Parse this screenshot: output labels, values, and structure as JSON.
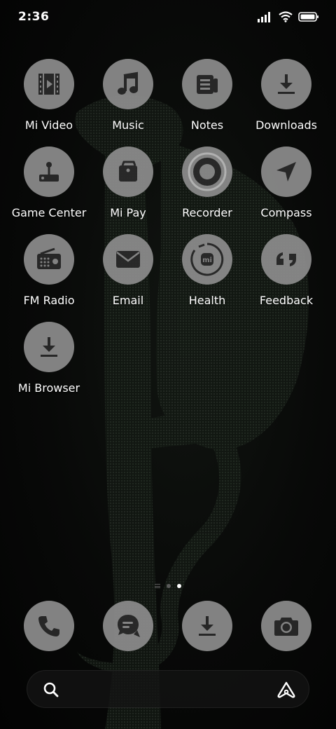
{
  "status_bar": {
    "time": "2:36",
    "icons": [
      "signal-icon",
      "wifi-icon",
      "battery-icon"
    ]
  },
  "apps": [
    {
      "label": "Mi Video",
      "icon": "video-icon"
    },
    {
      "label": "Music",
      "icon": "music-icon"
    },
    {
      "label": "Notes",
      "icon": "notes-icon"
    },
    {
      "label": "Downloads",
      "icon": "download-icon"
    },
    {
      "label": "Game Center",
      "icon": "joystick-icon"
    },
    {
      "label": "Mi Pay",
      "icon": "wallet-icon"
    },
    {
      "label": "Recorder",
      "icon": "record-icon"
    },
    {
      "label": "Compass",
      "icon": "compass-icon"
    },
    {
      "label": "FM Radio",
      "icon": "radio-icon"
    },
    {
      "label": "Email",
      "icon": "mail-icon"
    },
    {
      "label": "Health",
      "icon": "health-icon"
    },
    {
      "label": "Feedback",
      "icon": "feedback-icon"
    },
    {
      "label": "Mi Browser",
      "icon": "download-icon"
    }
  ],
  "page_indicator": {
    "pages": 3,
    "active": 2
  },
  "dock": [
    {
      "name": "phone",
      "icon": "phone-icon"
    },
    {
      "name": "messages",
      "icon": "message-icon"
    },
    {
      "name": "downloads",
      "icon": "download-icon"
    },
    {
      "name": "camera",
      "icon": "camera-icon"
    }
  ],
  "search": {
    "placeholder": "",
    "assistant_icon": "assistant-icon"
  },
  "colors": {
    "icon_bg": "#8c8c8c",
    "glyph": "#2a2a2a",
    "text": "#ffffff"
  }
}
